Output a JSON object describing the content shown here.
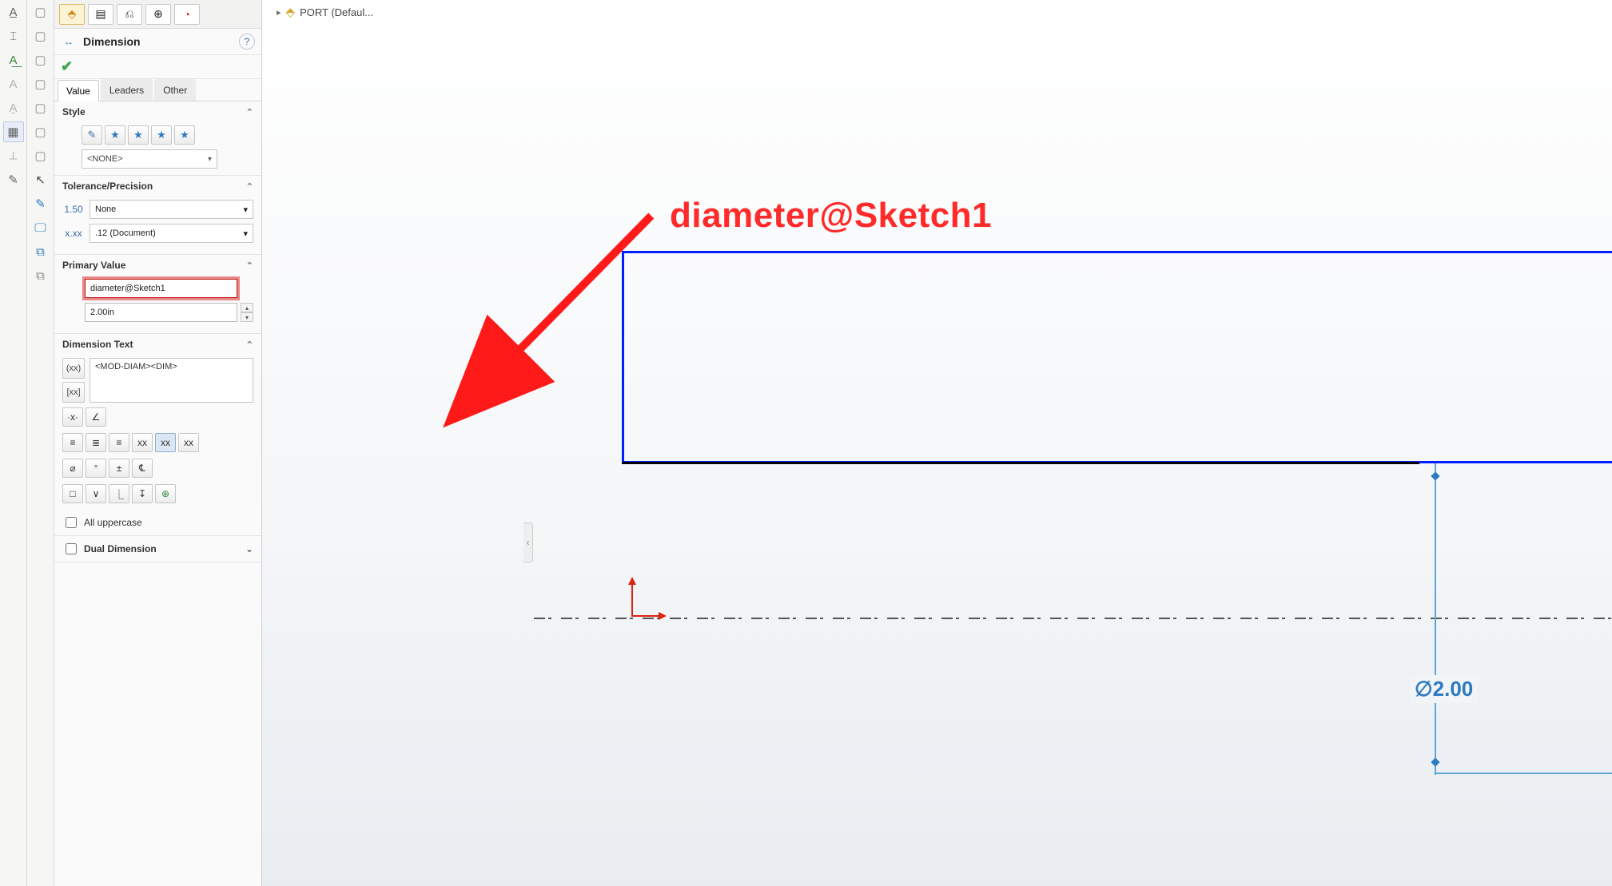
{
  "tree": {
    "crumb_label": "PORT  (Defaul..."
  },
  "header": {
    "title": "Dimension"
  },
  "tabs": {
    "value": "Value",
    "leaders": "Leaders",
    "other": "Other"
  },
  "sections": {
    "style": {
      "title": "Style",
      "combo": "<NONE>"
    },
    "tolerance": {
      "title": "Tolerance/Precision",
      "tol_combo": "None",
      "prec_combo": ".12 (Document)"
    },
    "primary": {
      "title": "Primary Value",
      "name": "diameter@Sketch1",
      "value": "2.00in"
    },
    "dimtext": {
      "title": "Dimension Text",
      "text": "<MOD-DIAM><DIM>",
      "all_upper": "All uppercase"
    },
    "dual": {
      "title": "Dual Dimension"
    }
  },
  "viewport": {
    "annotation": "diameter@Sketch1",
    "dim_label": "∅2.00"
  }
}
